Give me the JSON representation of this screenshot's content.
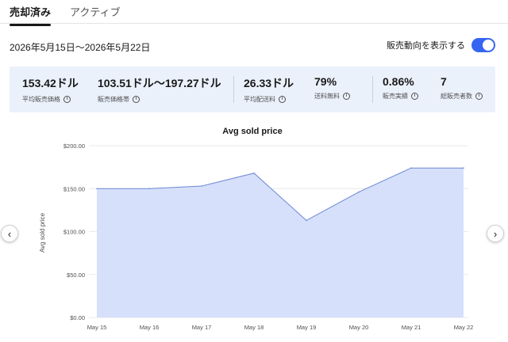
{
  "tabs": [
    {
      "label": "売却済み",
      "active": true
    },
    {
      "label": "アクティブ",
      "active": false
    }
  ],
  "date_range": "2026年5月15日〜2026年5月22日",
  "trend_toggle": {
    "label": "販売動向を表示する",
    "on": true
  },
  "stats": [
    {
      "value": "153.42ドル",
      "label": "平均販売価格"
    },
    {
      "value": "103.51ドル〜197.27ドル",
      "label": "販売価格帯"
    },
    {
      "value": "26.33ドル",
      "label": "平均配送料"
    },
    {
      "value": "79%",
      "label": "送料無料"
    },
    {
      "value": "0.86%",
      "label": "販売実績"
    },
    {
      "value": "7",
      "label": "総販売者数"
    }
  ],
  "nav": {
    "prev": "‹",
    "next": "›"
  },
  "colors": {
    "accent": "#3665f3",
    "area_fill": "#d6e0fb",
    "area_line": "#6d87d4",
    "stats_bg": "#eaf1fb"
  },
  "chart_data": {
    "type": "area",
    "title": "Avg sold price",
    "ylabel": "Avg sold price",
    "xlabel": "",
    "x": [
      "May 15",
      "May 16",
      "May 17",
      "May 18",
      "May 19",
      "May 20",
      "May 21",
      "May 22"
    ],
    "values": [
      150,
      150,
      153,
      168,
      113,
      146,
      174,
      174
    ],
    "yticks": [
      "$0.00",
      "$50.00",
      "$100.00",
      "$150.00",
      "$200.00"
    ],
    "ylim": [
      0,
      200
    ],
    "grid": true,
    "legend": "none"
  }
}
